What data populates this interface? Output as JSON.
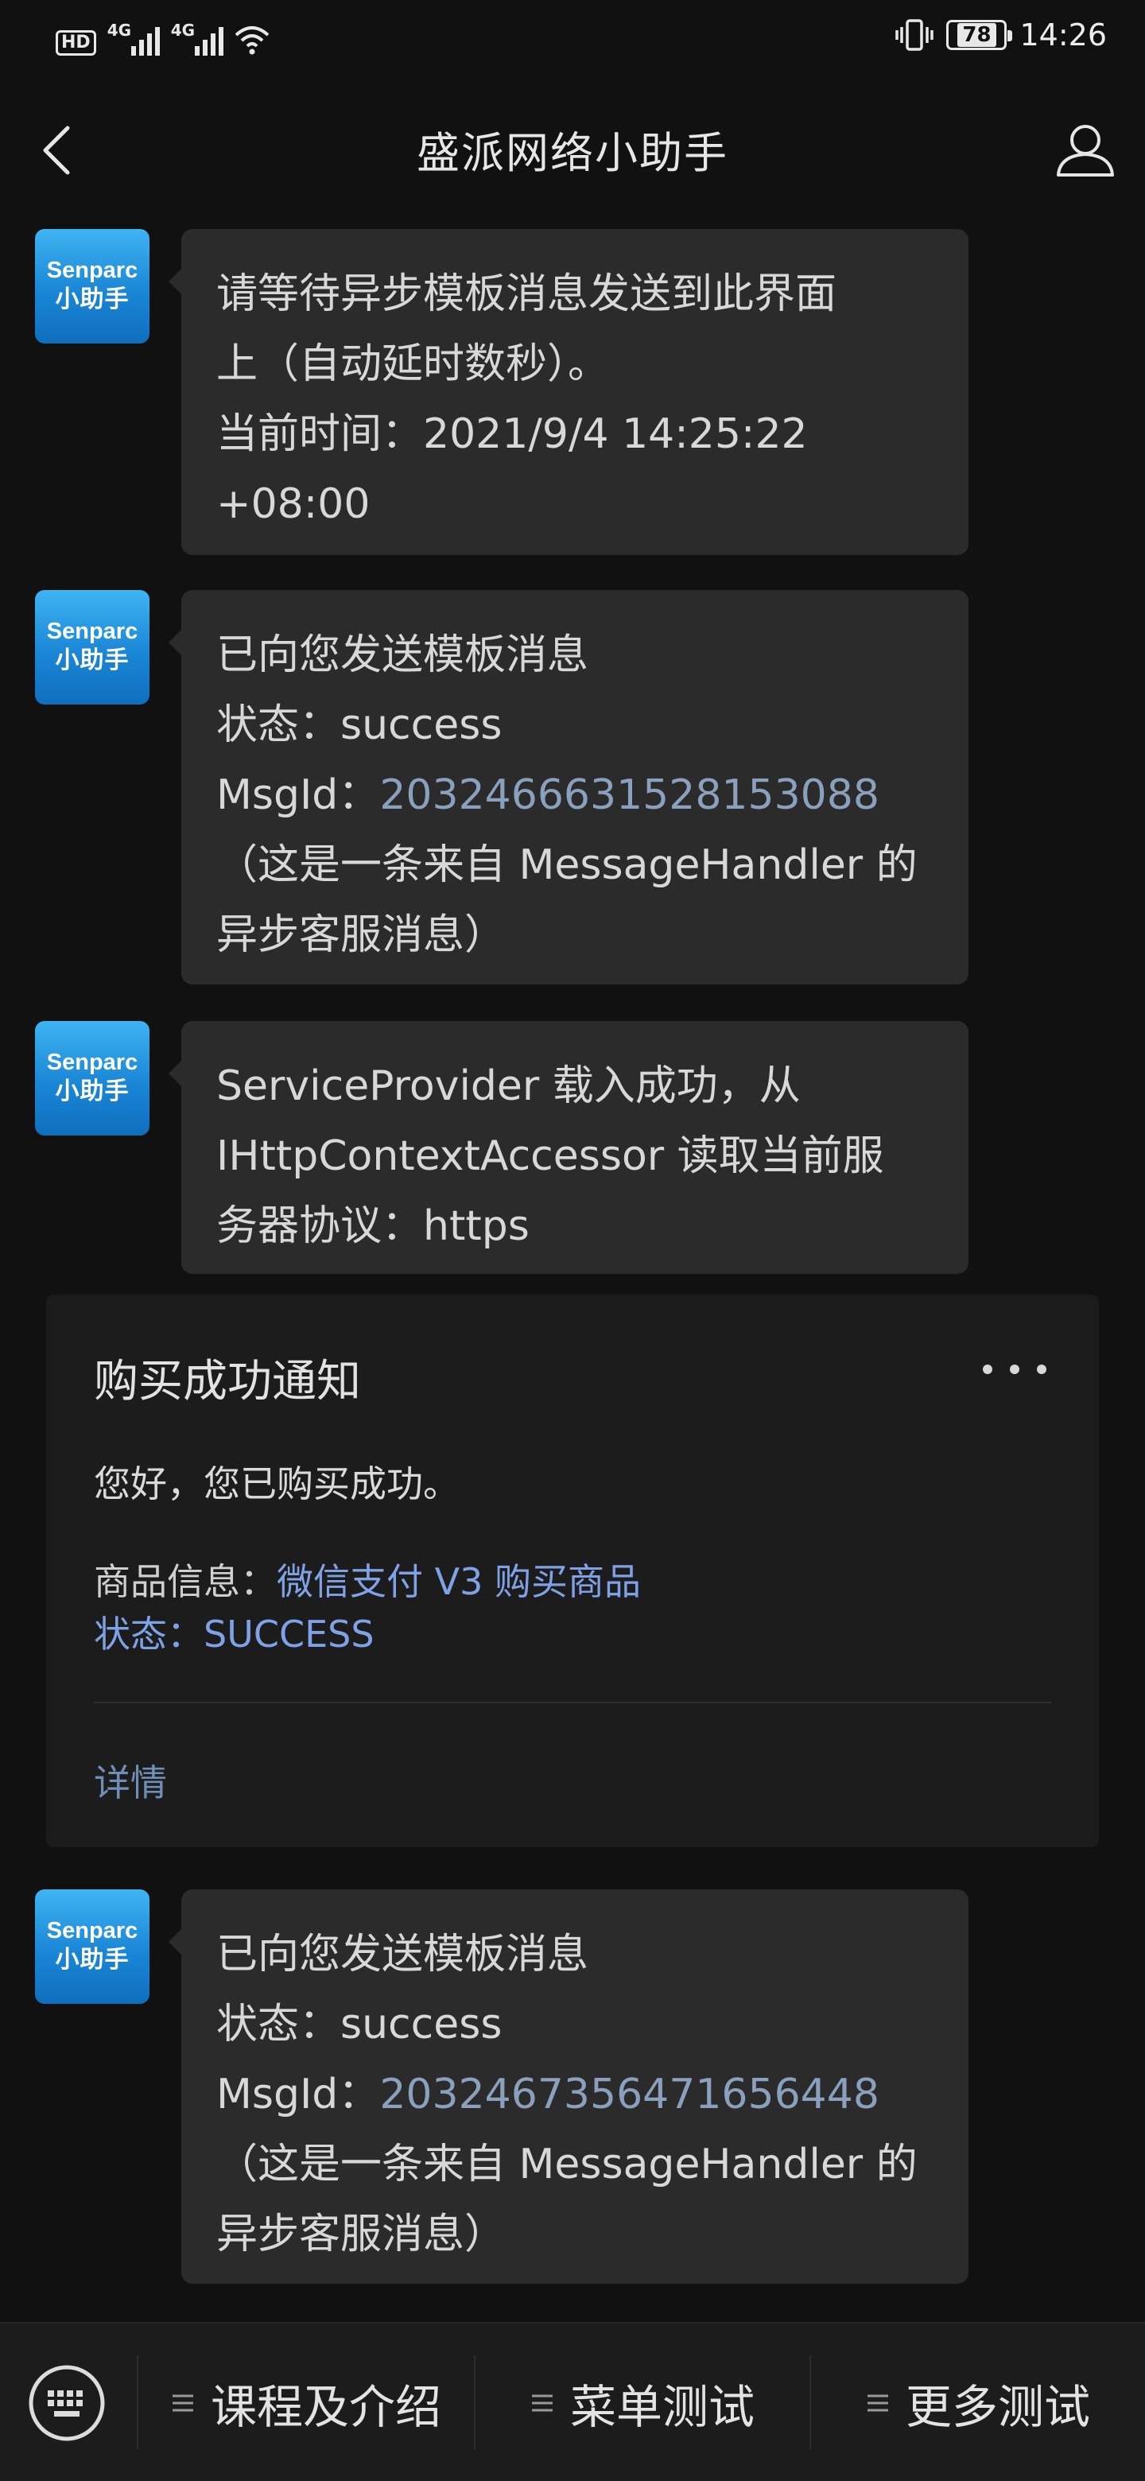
{
  "status_bar": {
    "hd_label": "HD",
    "sim1_tag": "4G",
    "sim2_tag": "4G",
    "battery_level": "78",
    "time": "14:26"
  },
  "header": {
    "title": "盛派网络小助手",
    "back_icon": "chevron-left-icon",
    "profile_icon": "person-icon"
  },
  "bot_avatar": {
    "line1": "Senparc",
    "line2": "小助手"
  },
  "messages": [
    {
      "lines": [
        "请等待异步模板消息发送到此界面",
        "上（自动延时数秒）。",
        "当前时间：2021/9/4 14:25:22",
        "+08:00"
      ]
    },
    {
      "line1": "已向您发送模板消息",
      "status": "状态：success",
      "msgid_label": "MsgId：",
      "msgid_value": "2032466631528153088",
      "line4": "（这是一条来自 MessageHandler 的",
      "line5": "异步客服消息）"
    },
    {
      "lines": [
        "ServiceProvider 载入成功，从",
        "IHttpContextAccessor 读取当前服",
        "务器协议：https"
      ]
    },
    {
      "line1": "已向您发送模板消息",
      "status": "状态：success",
      "msgid_label": "MsgId：",
      "msgid_value": "2032467356471656448",
      "line4": "（这是一条来自 MessageHandler 的",
      "line5": "异步客服消息）"
    }
  ],
  "template_card": {
    "title": "购买成功通知",
    "greeting": "您好，您已购买成功。",
    "product_label": "商品信息：",
    "product_value": "微信支付 V3 购买商品",
    "status_label": "状态：",
    "status_value": "SUCCESS",
    "detail_link": "详情"
  },
  "bottom_menu": {
    "keyboard_icon": "keyboard-icon",
    "items": [
      {
        "label": "课程及介绍"
      },
      {
        "label": "菜单测试"
      },
      {
        "label": "更多测试"
      }
    ]
  },
  "colors": {
    "background": "#111111",
    "bubble": "#2b2b2b",
    "card": "#1c1c1c",
    "link_blue": "#7fa2e6",
    "avatar_blue": "#1a86d6"
  }
}
